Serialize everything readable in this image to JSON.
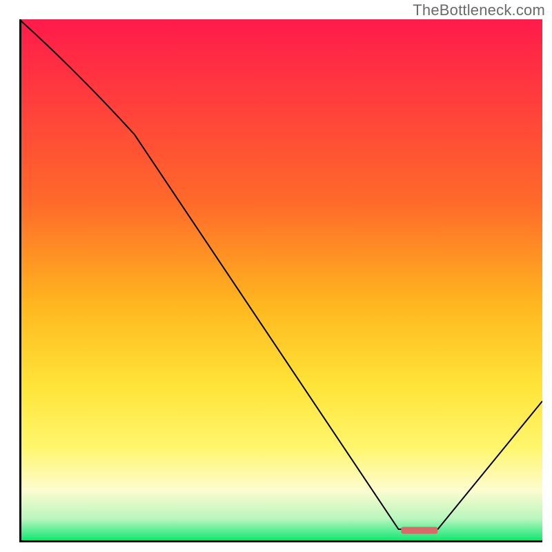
{
  "watermark": "TheBottleneck.com",
  "chart_data": {
    "type": "line",
    "title": "",
    "xlabel": "",
    "ylabel": "",
    "xlim": [
      0,
      100
    ],
    "ylim": [
      0,
      100
    ],
    "grid": false,
    "legend": false,
    "gradient_background": {
      "stops": [
        {
          "pos": 0.0,
          "color": "#ff1a4b"
        },
        {
          "pos": 0.35,
          "color": "#ff6a2a"
        },
        {
          "pos": 0.55,
          "color": "#ffb81f"
        },
        {
          "pos": 0.7,
          "color": "#ffe438"
        },
        {
          "pos": 0.82,
          "color": "#fff66e"
        },
        {
          "pos": 0.9,
          "color": "#fdfccf"
        },
        {
          "pos": 0.955,
          "color": "#b7f7be"
        },
        {
          "pos": 1.0,
          "color": "#00e56a"
        }
      ]
    },
    "series": [
      {
        "name": "bottleneck-curve",
        "x": [
          0,
          22,
          72.5,
          80,
          100
        ],
        "y": [
          100,
          78,
          2.5,
          2.5,
          27
        ],
        "stroke": "#000000",
        "stroke_width": 2
      }
    ],
    "marker": {
      "name": "xsweet-spot",
      "x_range": [
        73,
        80
      ],
      "y": 2.3,
      "color": "#d96a6a",
      "rx": 3,
      "height": 10
    },
    "axes": {
      "left": true,
      "bottom": true,
      "color": "#000000",
      "width": 6
    }
  }
}
